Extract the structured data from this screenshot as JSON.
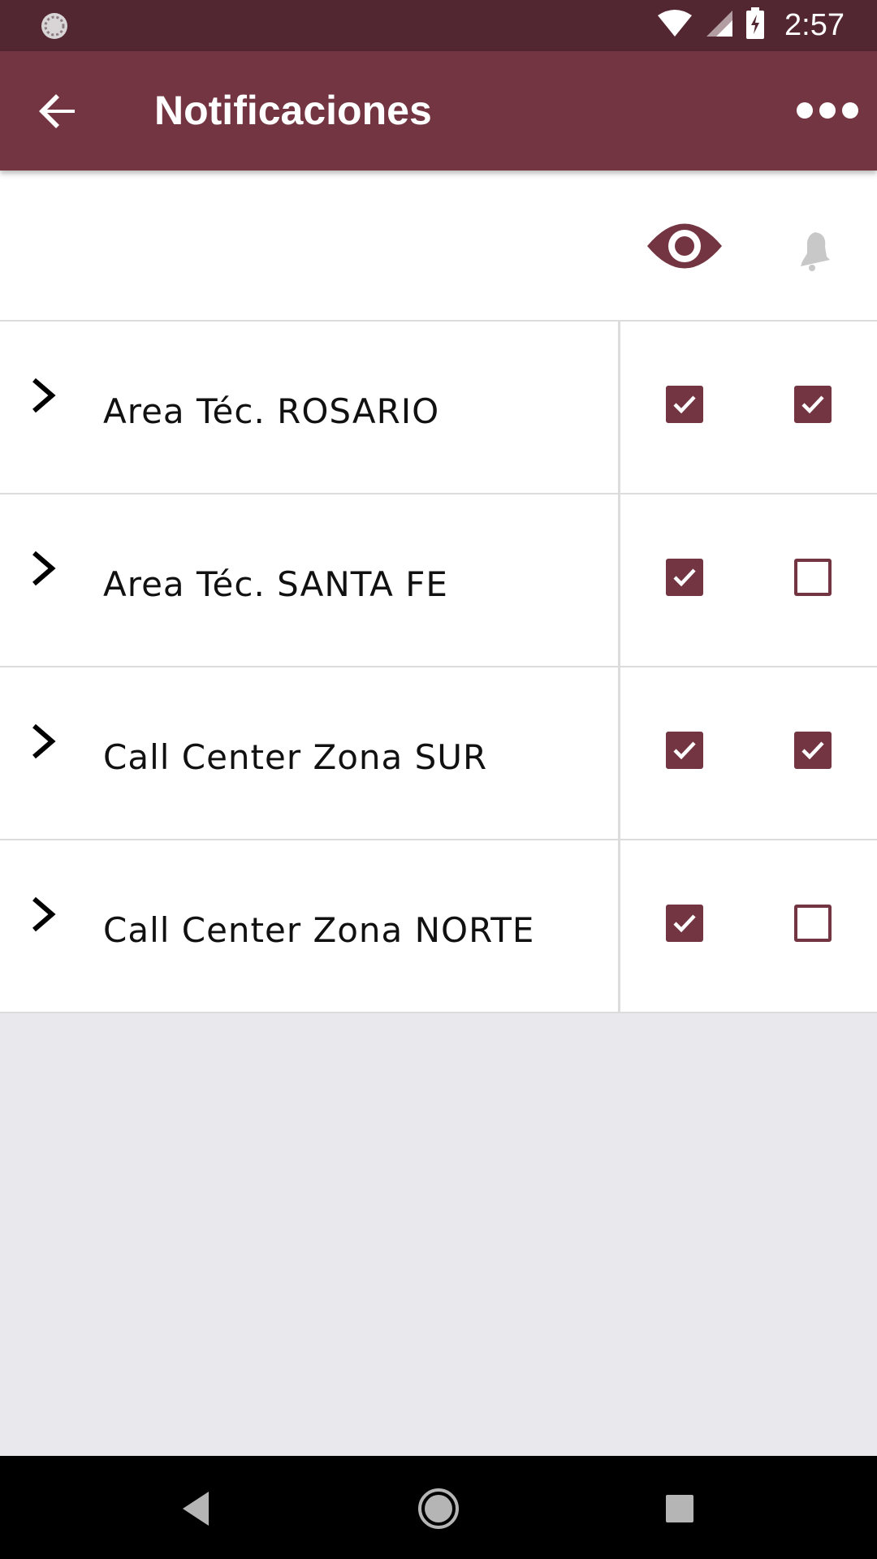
{
  "status_bar": {
    "time": "2:57",
    "icons": [
      "loading-icon",
      "wifi-icon",
      "signal-icon",
      "battery-charging-icon"
    ]
  },
  "app_bar": {
    "title": "Notificaciones",
    "back_icon": "arrow-back-icon",
    "overflow_icon": "more-horiz-icon"
  },
  "columns": {
    "view_icon": "eye-icon",
    "notify_icon": "bell-icon"
  },
  "rows": [
    {
      "label": "Area Téc. ROSARIO",
      "view": true,
      "notify": true
    },
    {
      "label": "Area Téc. SANTA FE",
      "view": true,
      "notify": false
    },
    {
      "label": "Call Center Zona SUR",
      "view": true,
      "notify": true
    },
    {
      "label": "Call Center Zona NORTE",
      "view": true,
      "notify": false
    }
  ],
  "nav_bar": {
    "icons": [
      "nav-back-icon",
      "nav-home-icon",
      "nav-recent-icon"
    ]
  },
  "colors": {
    "status_bar": "#522731",
    "app_bar": "#733542",
    "accent": "#733542",
    "bell_inactive": "#c8c8c8",
    "empty_background": "#e9e8ed"
  }
}
